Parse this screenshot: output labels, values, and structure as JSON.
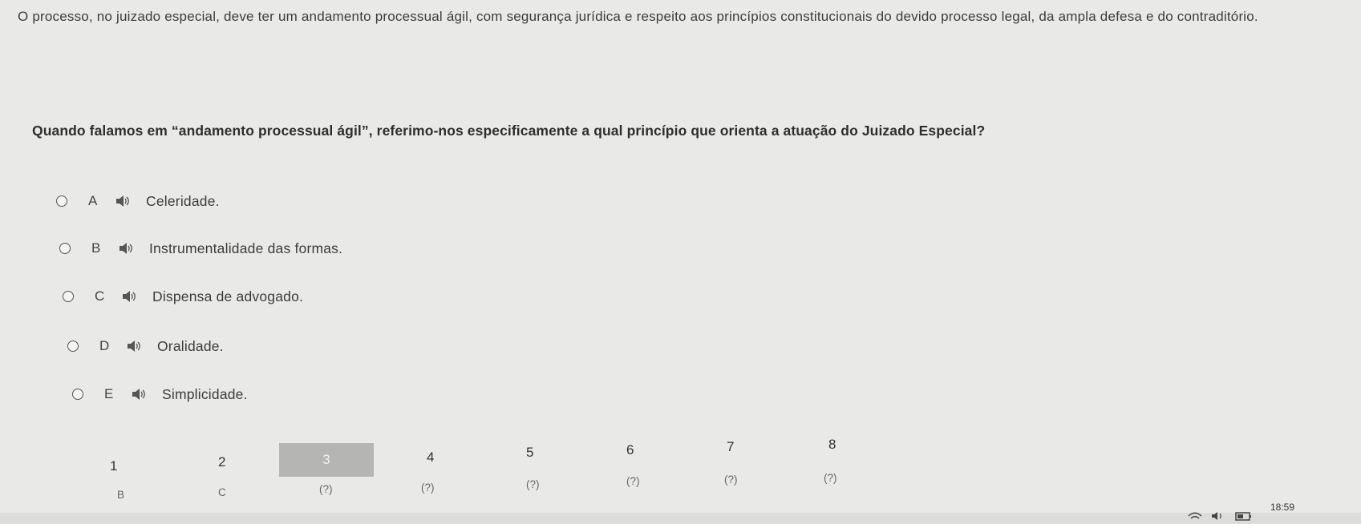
{
  "passage": "O processo, no juizado especial, deve ter um andamento processual ágil, com segurança jurídica e respeito aos princípios constitucionais do devido processo legal, da ampla defesa e do contraditório.",
  "question": "Quando falamos em “andamento processual ágil”, referimo-nos especificamente a qual princípio que orienta a atuação do Juizado Especial?",
  "options": [
    {
      "letter": "A",
      "text": "Celeridade."
    },
    {
      "letter": "B",
      "text": "Instrumentalidade das formas."
    },
    {
      "letter": "C",
      "text": "Dispensa de advogado."
    },
    {
      "letter": "D",
      "text": "Oralidade."
    },
    {
      "letter": "E",
      "text": "Simplicidade."
    }
  ],
  "navigation": {
    "numbers": [
      "1",
      "2",
      "3",
      "4",
      "5",
      "6",
      "7",
      "8"
    ],
    "active": "3",
    "answers": [
      "B",
      "C",
      "(?)",
      "(?)",
      "(?)",
      "(?)",
      "(?)",
      "(?)"
    ]
  },
  "taskbar": {
    "time": "18:59",
    "tray_icons": [
      "wifi-icon",
      "volume-icon",
      "battery-icon"
    ]
  }
}
